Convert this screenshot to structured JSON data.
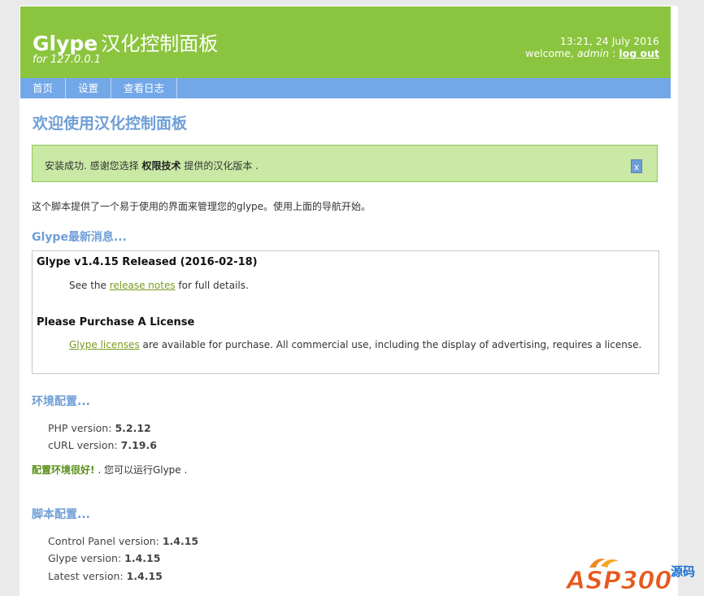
{
  "header": {
    "brand": "Glype",
    "brand_cn": "汉化控制面板",
    "subtitle": "for 127.0.0.1",
    "datetime": "13:21, 24 July 2016",
    "welcome_prefix": "welcome,",
    "user": "admin",
    "separator": ":",
    "logout": "log out"
  },
  "nav": [
    "首页",
    "设置",
    "查看日志"
  ],
  "page_title": "欢迎使用汉化控制面板",
  "notice": {
    "text_before": "安装成功. 感谢您选择",
    "bold": "权限技术",
    "text_after": "提供的汉化版本 .",
    "close": "x"
  },
  "intro": "这个脚本提供了一个易于使用的界面来管理您的glype。使用上面的导航开始。",
  "news": {
    "heading": "Glype最新消息...",
    "items": [
      {
        "title": "Glype v1.4.15 Released (2016-02-18)",
        "prefix": "See the",
        "link": "release notes",
        "suffix": "for full details."
      },
      {
        "title": "Please Purchase A License",
        "prefix": "",
        "link": "Glype licenses",
        "suffix": "are available for purchase. All commercial use, including the display of advertising, requires a license."
      }
    ]
  },
  "env": {
    "heading": "环境配置...",
    "php_label": "PHP version:",
    "php_value": "5.2.12",
    "curl_label": "cURL version:",
    "curl_value": "7.19.6",
    "ok_bold": "配置环境很好!",
    "ok_rest": ". 您可以运行Glype ."
  },
  "script": {
    "heading": "脚本配置...",
    "cp_label": "Control Panel version:",
    "cp_value": "1.4.15",
    "glype_label": "Glype version:",
    "glype_value": "1.4.15",
    "latest_label": "Latest version:",
    "latest_value": "1.4.15"
  },
  "watermark": {
    "text": "ASP300",
    "suffix": "源码"
  },
  "colors": {
    "header_green": "#8bc53f",
    "nav_blue": "#73a8e8",
    "heading_blue": "#6f9ed6"
  }
}
